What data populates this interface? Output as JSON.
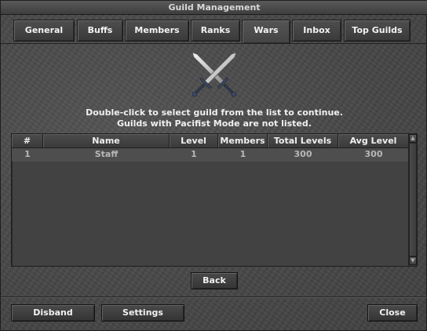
{
  "window": {
    "title": "Guild Management"
  },
  "tabs": [
    {
      "label": "General"
    },
    {
      "label": "Buffs"
    },
    {
      "label": "Members"
    },
    {
      "label": "Ranks"
    },
    {
      "label": "Wars"
    },
    {
      "label": "Inbox"
    },
    {
      "label": "Top Guilds"
    }
  ],
  "active_tab": "Wars",
  "emblem": {
    "icon": "crossed-swords-icon"
  },
  "instructions": {
    "line1": "Double-click to select guild from the list to continue.",
    "line2": "Guilds with Pacifist Mode are not listed."
  },
  "table": {
    "columns": [
      "#",
      "Name",
      "Level",
      "Members",
      "Total Levels",
      "Avg Level"
    ],
    "rows": [
      {
        "num": "1",
        "name": "Staff",
        "level": "1",
        "members": "1",
        "total_levels": "300",
        "avg_level": "300"
      }
    ]
  },
  "buttons": {
    "back": "Back",
    "disband": "Disband",
    "settings": "Settings",
    "close": "Close"
  },
  "colors": {
    "background": "#4a4a4a",
    "text": "#f0f0f0",
    "row_text": "#b8b8b8"
  }
}
